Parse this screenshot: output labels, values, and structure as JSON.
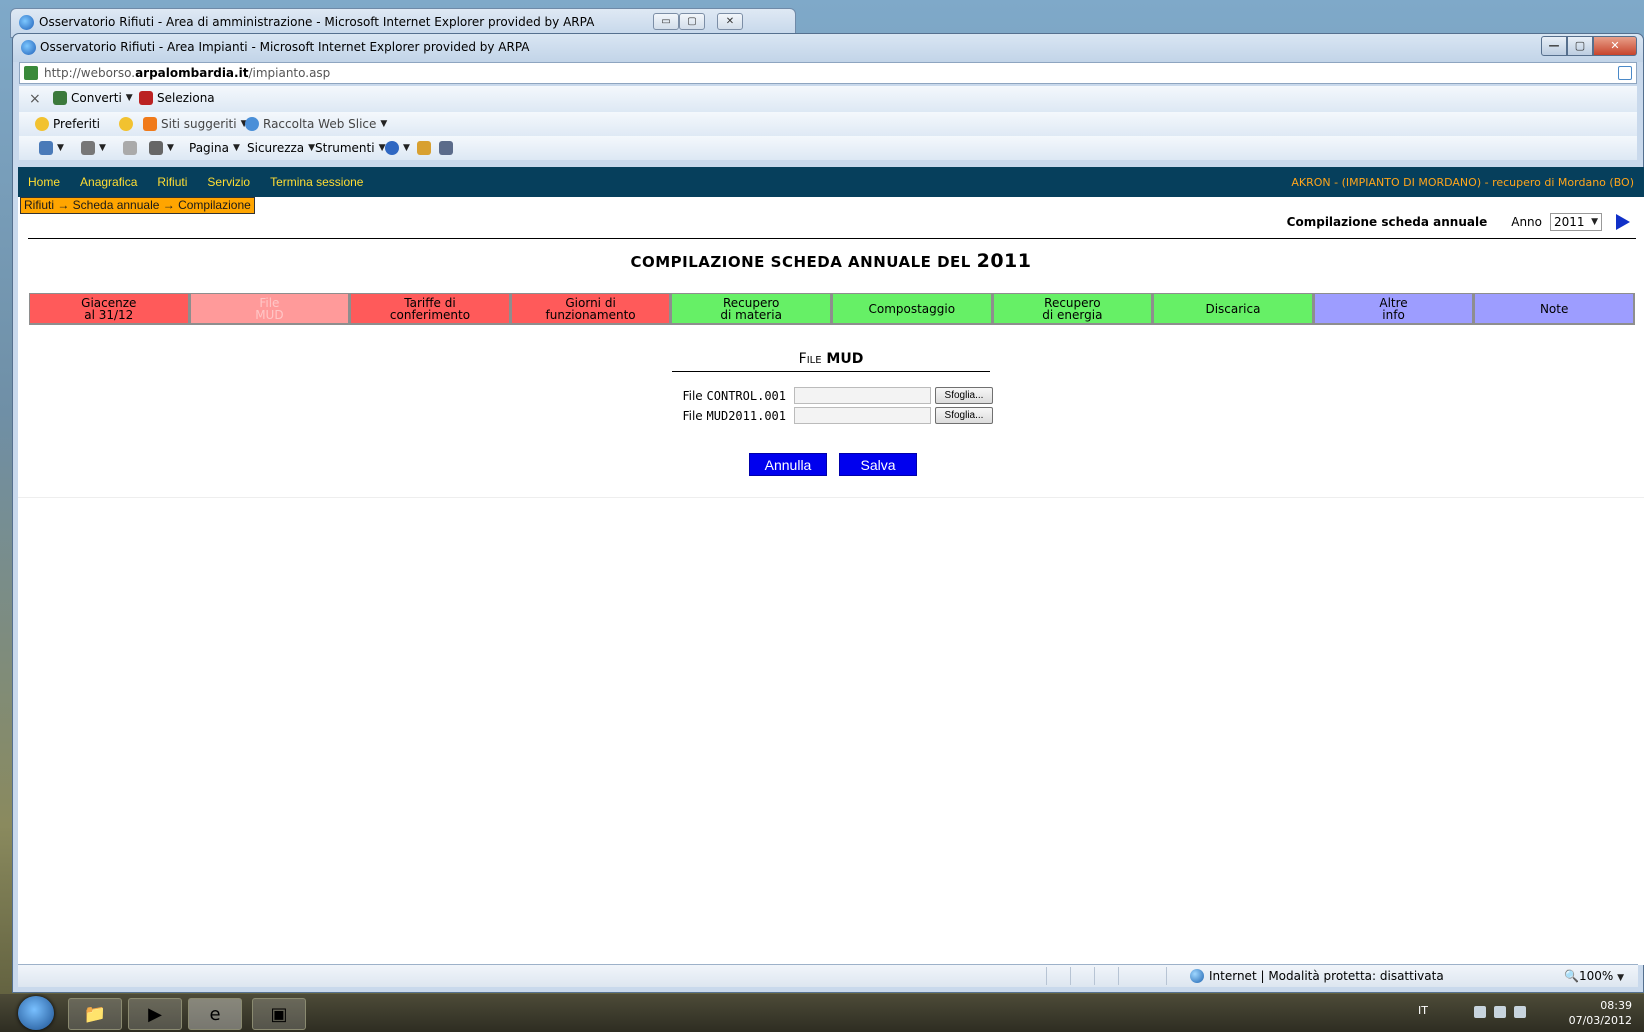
{
  "browser": {
    "background_window_title": "Osservatorio Rifiuti - Area di amministrazione - Microsoft Internet Explorer provided by ARPA",
    "window_title": "Osservatorio Rifiuti - Area Impianti - Microsoft Internet Explorer provided by ARPA",
    "url_prefix": "http://weborso.",
    "url_domain": "arpalombardia.it",
    "url_path": "/impianto.asp",
    "toolbar1": {
      "close": "×",
      "converti": "Converti",
      "seleziona": "Seleziona"
    },
    "favorites_bar": {
      "preferiti": "Preferiti",
      "siti_suggeriti": "Siti suggeriti",
      "web_slice": "Raccolta Web Slice"
    },
    "command_bar": {
      "pagina": "Pagina",
      "sicurezza": "Sicurezza",
      "strumenti": "Strumenti"
    },
    "status": {
      "zone": "Internet | Modalità protetta: disattivata",
      "zoom": "100%"
    }
  },
  "nav": {
    "links": [
      "Home",
      "Anagrafica",
      "Rifiuti",
      "Servizio",
      "Termina sessione"
    ],
    "plant": "AKRON - (IMPIANTO DI MORDANO) - recupero di Mordano (BO)"
  },
  "breadcrumb": "Rifiuti → Scheda annuale → Compilazione",
  "year_selector": {
    "heading": "Compilazione scheda annuale",
    "label": "Anno",
    "value": "2011"
  },
  "page_title": {
    "prefix": "Compilazione scheda annuale del",
    "year": "2011"
  },
  "tabs": [
    {
      "label": "Giacenze\nal 31/12",
      "color": "#ff5a5a"
    },
    {
      "label": "File\nMUD",
      "color": "#ff9a9a",
      "active": true
    },
    {
      "label": "Tariffe di\nconferimento",
      "color": "#ff5a5a"
    },
    {
      "label": "Giorni di\nfunzionamento",
      "color": "#ff5a5a"
    },
    {
      "label": "Recupero\ndi materia",
      "color": "#66f066"
    },
    {
      "label": "Compostaggio",
      "color": "#66f066"
    },
    {
      "label": "Recupero\ndi energia",
      "color": "#66f066"
    },
    {
      "label": "Discarica",
      "color": "#66f066"
    },
    {
      "label": "Altre\ninfo",
      "color": "#9d9dff"
    },
    {
      "label": "Note",
      "color": "#9d9dff"
    }
  ],
  "section": {
    "title_prefix": "File",
    "title_main": "MUD"
  },
  "file_fields": [
    {
      "label": "File",
      "filename": "CONTROL.001",
      "value": "",
      "button": "Sfoglia..."
    },
    {
      "label": "File",
      "filename": "MUD2011.001",
      "value": "",
      "button": "Sfoglia..."
    }
  ],
  "actions": {
    "cancel": "Annulla",
    "save": "Salva"
  },
  "taskbar": {
    "lang": "IT",
    "time": "08:39",
    "date": "07/03/2012"
  }
}
